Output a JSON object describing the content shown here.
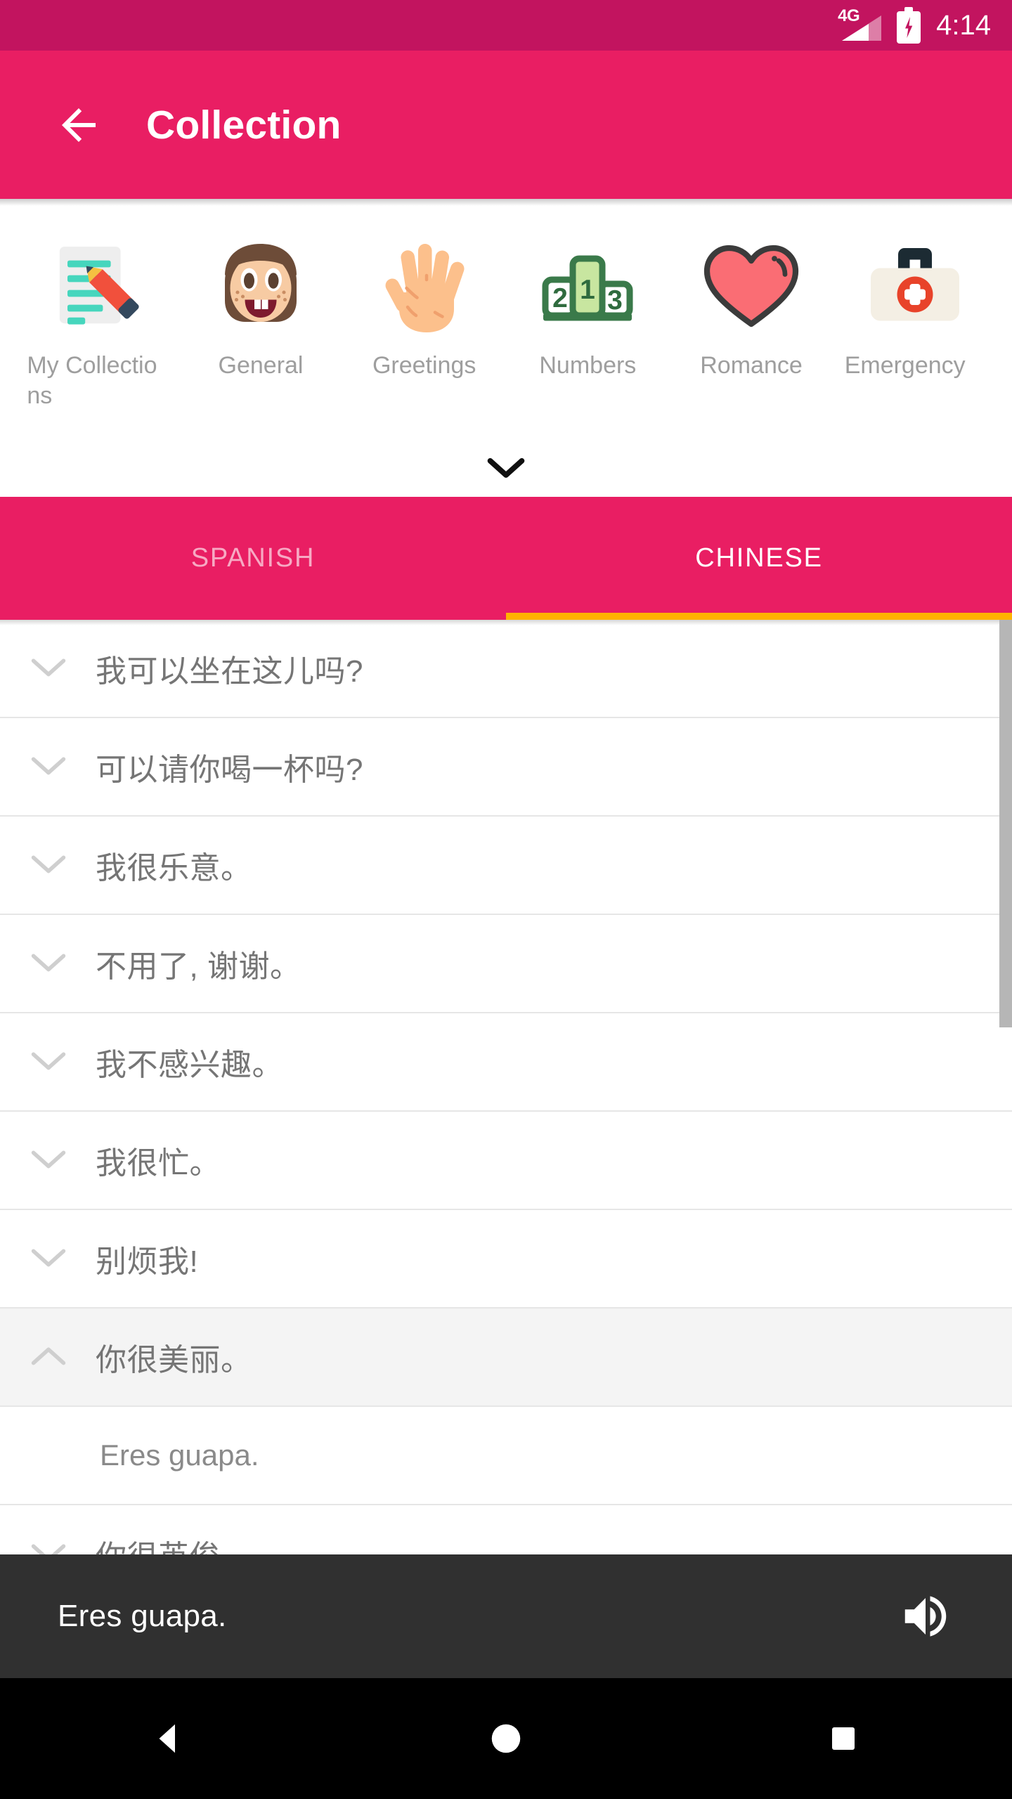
{
  "status_bar": {
    "network_label": "4G",
    "time": "4:14",
    "battery_icon": "battery-charging-icon",
    "signal_icon": "signal-bars-icon"
  },
  "app_bar": {
    "back_icon": "arrow-left-icon",
    "title": "Collection",
    "background": "#e91e63"
  },
  "categories": {
    "expand_icon": "chevron-down-icon",
    "items": [
      {
        "label": "My Collections",
        "icon": "memo-pencil-icon"
      },
      {
        "label": "General",
        "icon": "girl-face-icon"
      },
      {
        "label": "Greetings",
        "icon": "open-hand-icon"
      },
      {
        "label": "Numbers",
        "icon": "podium-123-icon"
      },
      {
        "label": "Romance",
        "icon": "heart-icon"
      },
      {
        "label": "Emergency",
        "icon": "first-aid-kit-icon"
      }
    ]
  },
  "tabs": {
    "items": [
      {
        "label": "SPANISH",
        "active": false
      },
      {
        "label": "CHINESE",
        "active": true
      }
    ],
    "indicator_color": "#ffb300"
  },
  "phrase_list": {
    "collapsed_icon": "chevron-down-icon",
    "expanded_icon": "chevron-up-icon",
    "rows": [
      {
        "text": "我可以坐在这儿吗?",
        "expanded": false
      },
      {
        "text": "可以请你喝一杯吗?",
        "expanded": false
      },
      {
        "text": "我很乐意。",
        "expanded": false
      },
      {
        "text": "不用了, 谢谢。",
        "expanded": false
      },
      {
        "text": "我不感兴趣。",
        "expanded": false
      },
      {
        "text": "我很忙。",
        "expanded": false
      },
      {
        "text": "别烦我!",
        "expanded": false
      },
      {
        "text": "你很美丽。",
        "expanded": true,
        "translation": "Eres guapa."
      },
      {
        "text": "你很英俊",
        "expanded": false
      }
    ]
  },
  "player_bar": {
    "text": "Eres guapa.",
    "speaker_icon": "volume-up-icon",
    "background": "#303030"
  },
  "nav_bar": {
    "back": "triangle-back-icon",
    "home": "circle-home-icon",
    "recents": "square-recents-icon"
  }
}
